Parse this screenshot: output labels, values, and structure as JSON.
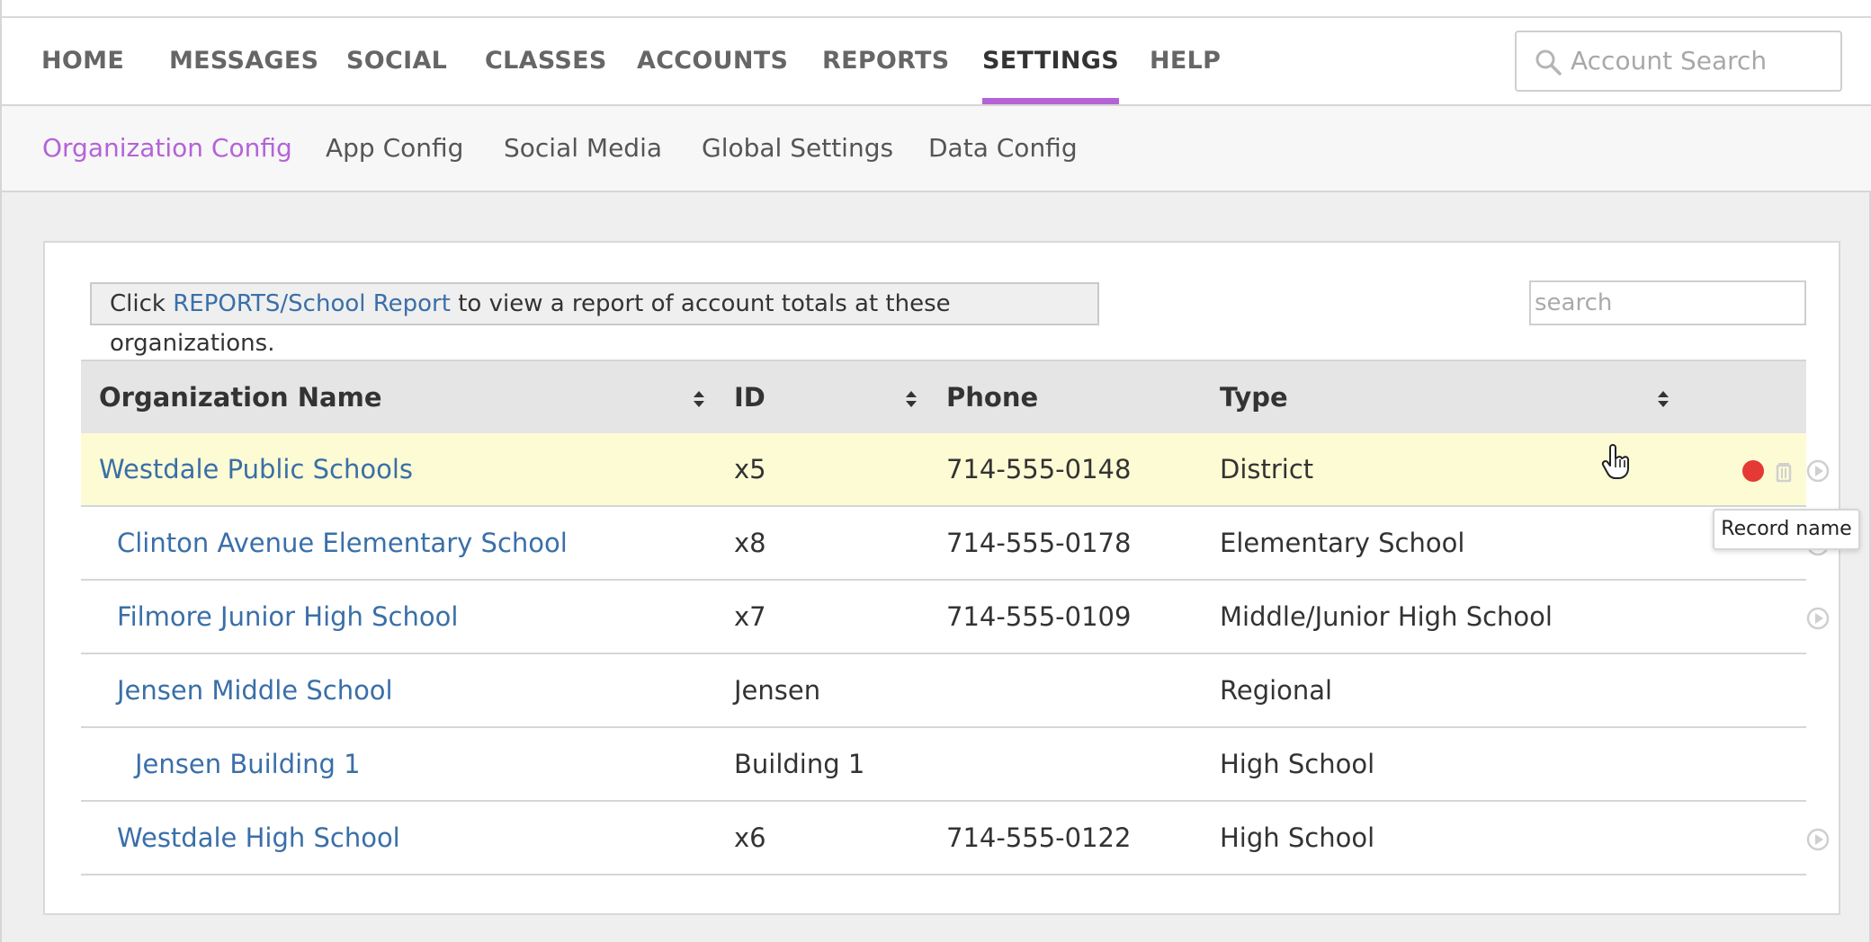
{
  "main_nav": {
    "items": [
      {
        "label": "HOME",
        "active": false
      },
      {
        "label": "MESSAGES",
        "active": false
      },
      {
        "label": "SOCIAL",
        "active": false
      },
      {
        "label": "CLASSES",
        "active": false
      },
      {
        "label": "ACCOUNTS",
        "active": false
      },
      {
        "label": "REPORTS",
        "active": false
      },
      {
        "label": "SETTINGS",
        "active": true
      },
      {
        "label": "HELP",
        "active": false
      }
    ],
    "search_placeholder": "Account Search",
    "active_color": "#b463d6"
  },
  "sub_nav": {
    "items": [
      {
        "label": "Organization Config",
        "active": true
      },
      {
        "label": "App Config",
        "active": false
      },
      {
        "label": "Social Media",
        "active": false
      },
      {
        "label": "Global Settings",
        "active": false
      },
      {
        "label": "Data Config",
        "active": false
      }
    ]
  },
  "notice": {
    "prefix": "Click ",
    "link": "REPORTS/School Report",
    "suffix": " to view a report of account totals at these organizations."
  },
  "table_search_placeholder": "search",
  "table": {
    "columns": [
      "Organization Name",
      "ID",
      "Phone",
      "Type"
    ],
    "rows": [
      {
        "name": "Westdale Public Schools",
        "id": "x5",
        "phone": "714-555-0148",
        "type": "District",
        "indent": 0,
        "highlighted": true
      },
      {
        "name": "Clinton Avenue Elementary School",
        "id": "x8",
        "phone": "714-555-0178",
        "type": "Elementary School",
        "indent": 1,
        "highlighted": false
      },
      {
        "name": "Filmore Junior High School",
        "id": "x7",
        "phone": "714-555-0109",
        "type": "Middle/Junior High School",
        "indent": 1,
        "highlighted": false
      },
      {
        "name": "Jensen Middle School",
        "id": "Jensen",
        "phone": "",
        "type": "Regional",
        "indent": 1,
        "highlighted": false
      },
      {
        "name": "Jensen Building 1",
        "id": "Building 1",
        "phone": "",
        "type": "High School",
        "indent": 2,
        "highlighted": false
      },
      {
        "name": "Westdale High School",
        "id": "x6",
        "phone": "714-555-0122",
        "type": "High School",
        "indent": 1,
        "highlighted": false
      }
    ]
  },
  "tooltip": "Record name",
  "colors": {
    "link": "#3a6fa8",
    "highlight_row": "#fdfbd4",
    "record_dot": "#e53935"
  }
}
